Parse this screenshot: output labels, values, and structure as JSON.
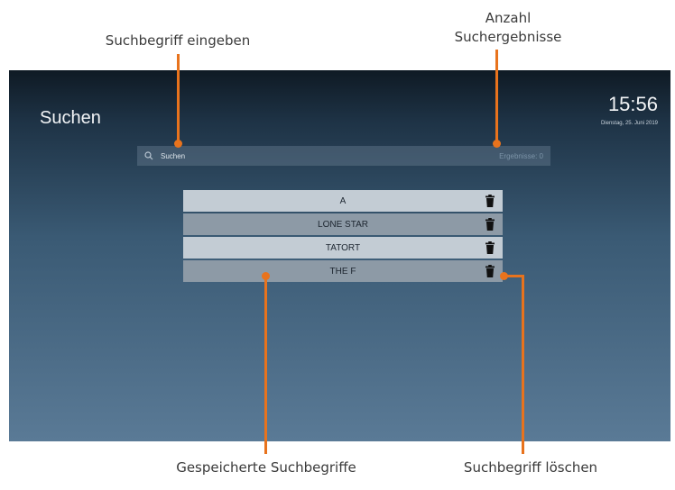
{
  "annotations": {
    "search_input": "Suchbegriff eingeben",
    "result_count_line1": "Anzahl",
    "result_count_line2": "Suchergebnisse",
    "saved_terms": "Gespeicherte Suchbegriffe",
    "delete_term": "Suchbegriff löschen"
  },
  "screen": {
    "title": "Suchen",
    "time": "15:56",
    "date": "Dienstag, 25. Juni 2019",
    "search": {
      "placeholder": "Suchen",
      "result_count": "Ergebnisse: 0"
    },
    "saved_searches": [
      {
        "label": "A"
      },
      {
        "label": "LONE STAR"
      },
      {
        "label": "TATORT"
      },
      {
        "label": "THE F"
      }
    ]
  },
  "colors": {
    "accent": "#e8731d",
    "row_light": "#c3ccd4",
    "row_dark": "#8d9aa6"
  }
}
